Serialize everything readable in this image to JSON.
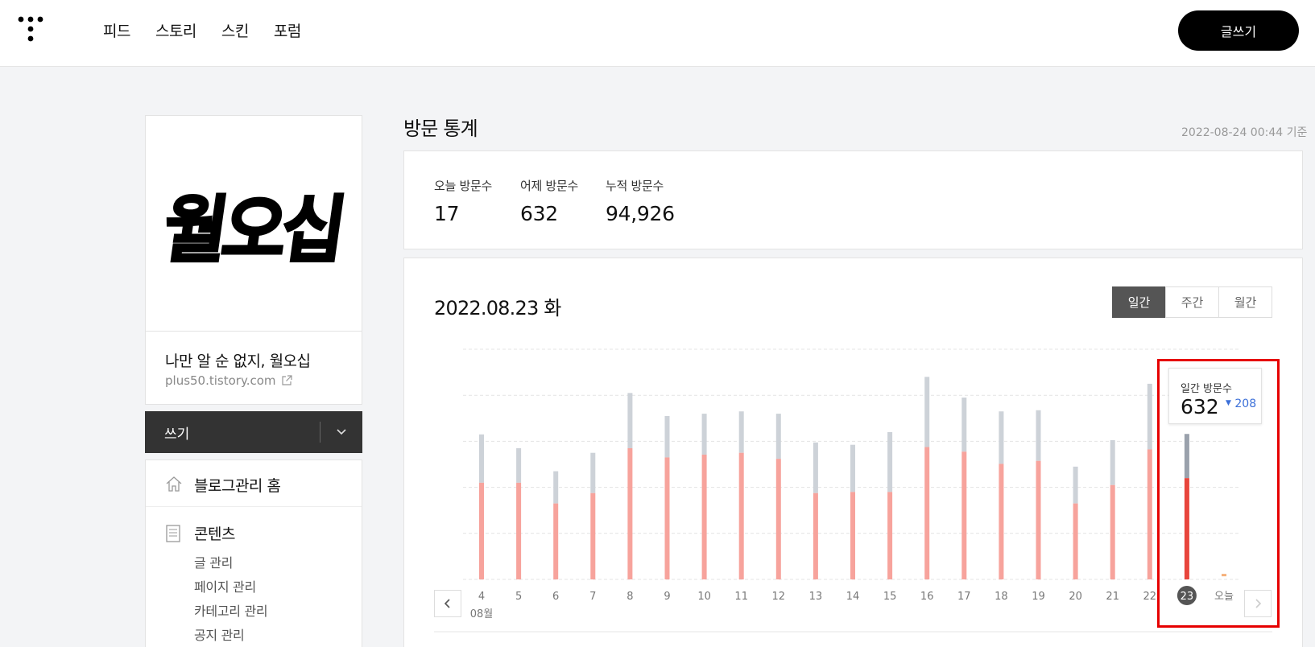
{
  "nav": {
    "items": [
      "피드",
      "스토리",
      "스킨",
      "포럼"
    ],
    "write_button": "글쓰기"
  },
  "sidebar": {
    "logo_text": "월오십",
    "blog_name": "나만 알 순 없지, 월오십",
    "blog_url": "plus50.tistory.com",
    "write_label": "쓰기",
    "menu_home": "블로그관리 홈",
    "menu_contents": "콘텐츠",
    "sub_items": [
      "글 관리",
      "페이지 관리",
      "카테고리 관리",
      "공지 관리"
    ]
  },
  "main": {
    "title": "방문 통계",
    "timestamp": "2022-08-24 00:44 기준",
    "stats": [
      {
        "label": "오늘 방문수",
        "value": "17"
      },
      {
        "label": "어제 방문수",
        "value": "632"
      },
      {
        "label": "누적 방문수",
        "value": "94,926"
      }
    ],
    "chart_date": "2022.08.23 화",
    "period_tabs": [
      "일간",
      "주간",
      "월간"
    ],
    "active_tab": "일간"
  },
  "tooltip": {
    "label": "일간 방문수",
    "value": "632",
    "diff": "208"
  },
  "chart_data": {
    "type": "bar",
    "categories": [
      "4",
      "5",
      "6",
      "7",
      "8",
      "9",
      "10",
      "11",
      "12",
      "13",
      "14",
      "15",
      "16",
      "17",
      "18",
      "19",
      "20",
      "21",
      "22",
      "23",
      "오늘"
    ],
    "month_label": "08월",
    "selected_category": "23",
    "series": [
      {
        "values": [
          420,
          420,
          330,
          375,
          570,
          530,
          542,
          550,
          524,
          375,
          380,
          380,
          575,
          555,
          502,
          515,
          330,
          410,
          565,
          440,
          17
        ]
      },
      {
        "values": [
          630,
          570,
          470,
          550,
          810,
          710,
          720,
          730,
          720,
          595,
          585,
          640,
          880,
          790,
          730,
          735,
          490,
          605,
          850,
          632,
          17
        ]
      }
    ],
    "colors": {
      "portion": "#f7a39c",
      "portion_selected": "#e8453c",
      "total": "#cdd2d8",
      "total_selected": "#9aa1ac",
      "today": "#f5b07a"
    },
    "ylim": [
      0,
      1000
    ],
    "grid": true
  }
}
